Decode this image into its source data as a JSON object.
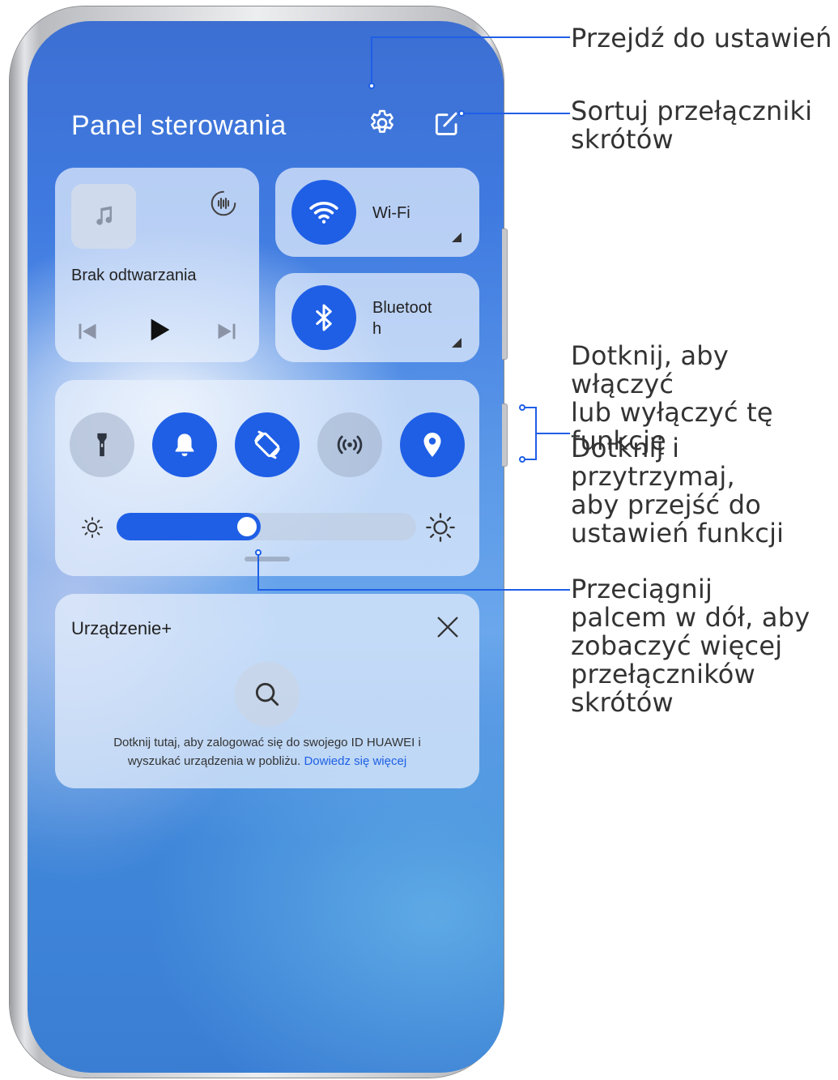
{
  "panel": {
    "title": "Panel sterowania",
    "settings_icon": "gear-icon",
    "edit_icon": "edit-icon"
  },
  "media": {
    "status": "Brak odtwarzania",
    "art_icon": "music-note-icon",
    "audio_icon": "audio-output-icon",
    "controls": [
      "previous-icon",
      "play-icon",
      "next-icon"
    ]
  },
  "tiles": {
    "wifi": {
      "label": "Wi-Fi",
      "icon": "wifi-icon",
      "state": "on"
    },
    "bluetooth": {
      "label_line1": "Bluetoot",
      "label_line2": "h",
      "icon": "bluetooth-icon",
      "state": "on"
    }
  },
  "toggles": [
    {
      "icon": "flashlight-icon",
      "state": "off"
    },
    {
      "icon": "bell-icon",
      "state": "on"
    },
    {
      "icon": "auto-rotate-icon",
      "state": "on"
    },
    {
      "icon": "hotspot-icon",
      "state": "off"
    },
    {
      "icon": "location-icon",
      "state": "on"
    }
  ],
  "brightness": {
    "level": 0.43
  },
  "device_card": {
    "title": "Urządzenie+",
    "info": "Dotknij tutaj, aby zalogować się do swojego ID HUAWEI i",
    "info_line2": "wyszukać urządzenia w pobliżu.",
    "link": "Dowiedz się więcej"
  },
  "callouts": {
    "settings": "Przejdź do ustawień",
    "sort_line1": "Sortuj przełączniki",
    "sort_line2": "skrótów",
    "toggle_line1": "Dotknij, aby włączyć",
    "toggle_line2": "lub wyłączyć tę",
    "toggle_line3": "funkcję",
    "hold_line1": "Dotknij i przytrzymaj,",
    "hold_line2": "aby przejść do",
    "hold_line3": "ustawień funkcji",
    "drag_line1": "Przeciągnij",
    "drag_line2": "palcem w dół, aby",
    "drag_line3": "zobaczyć więcej",
    "drag_line4": "przełączników",
    "drag_line5": "skrótów"
  },
  "colors": {
    "accent": "#1f5fe6",
    "callout_line": "#1f5fe6"
  }
}
